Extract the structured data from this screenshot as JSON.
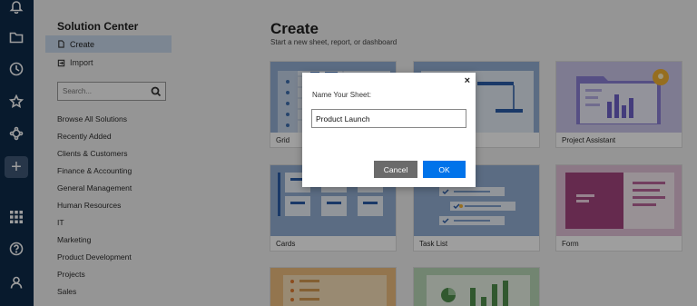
{
  "rail": {
    "icons": [
      "bell-icon",
      "folder-icon",
      "clock-icon",
      "star-icon",
      "connections-icon",
      "plus-icon",
      "apps-grid-icon",
      "help-icon",
      "user-icon"
    ],
    "plus_label": "+"
  },
  "sidebar": {
    "title": "Solution Center",
    "nav": [
      {
        "label": "Create",
        "selected": true
      },
      {
        "label": "Import",
        "selected": false
      }
    ],
    "search_placeholder": "Search...",
    "categories": [
      "Browse All Solutions",
      "Recently Added",
      "Clients & Customers",
      "Finance & Accounting",
      "General Management",
      "Human Resources",
      "IT",
      "Marketing",
      "Product Development",
      "Projects",
      "Sales"
    ]
  },
  "main": {
    "title": "Create",
    "subtitle": "Start a new sheet, report, or dashboard",
    "cards": [
      {
        "label": "Grid"
      },
      {
        "label": ""
      },
      {
        "label": "Project Assistant"
      },
      {
        "label": "Cards"
      },
      {
        "label": "Task List"
      },
      {
        "label": "Form"
      },
      {
        "label": ""
      },
      {
        "label": ""
      }
    ]
  },
  "dialog": {
    "close_label": "×",
    "prompt": "Name Your Sheet:",
    "input_value": "Product Launch",
    "cancel_label": "Cancel",
    "ok_label": "OK"
  },
  "colors": {
    "rail_bg": "#0d2a4a",
    "selected_nav": "#c9d9ec",
    "ok_button": "#0073ea",
    "cancel_button": "#6b6b6b"
  }
}
